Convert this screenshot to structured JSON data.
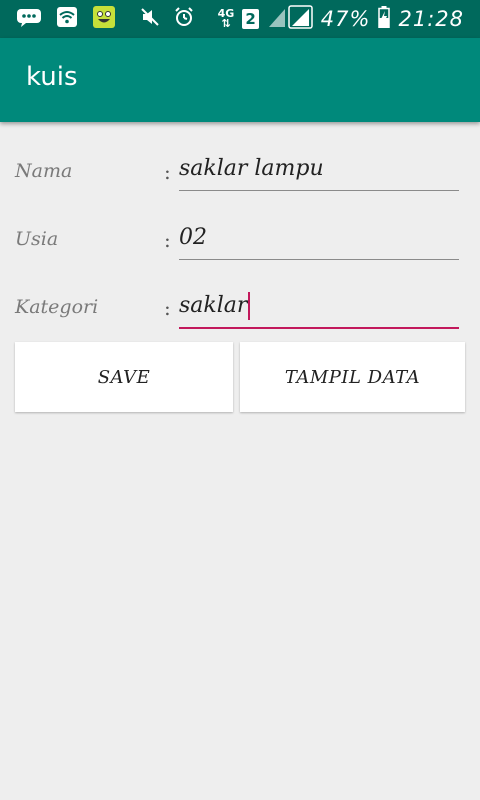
{
  "status_bar": {
    "battery_percent": "47%",
    "time": "21:28",
    "network_type": "4G",
    "sim_slot": "2",
    "icons": [
      "chat-icon",
      "wifi-icon",
      "emoji-icon",
      "mute-icon",
      "alarm-icon",
      "signal-icon",
      "battery-icon"
    ]
  },
  "app_bar": {
    "title": "kuis"
  },
  "form": {
    "fields": [
      {
        "label": "Nama",
        "separator": ":",
        "value": "saklar lampu"
      },
      {
        "label": "Usia",
        "separator": ":",
        "value": "02"
      },
      {
        "label": "Kategori",
        "separator": ":",
        "value": "saklar"
      }
    ]
  },
  "buttons": {
    "save_label": "SAVE",
    "show_data_label": "TAMPIL DATA"
  },
  "colors": {
    "status_bar": "#00695c",
    "app_bar": "#00897b",
    "accent": "#c2185b",
    "background": "#eeeeee"
  }
}
